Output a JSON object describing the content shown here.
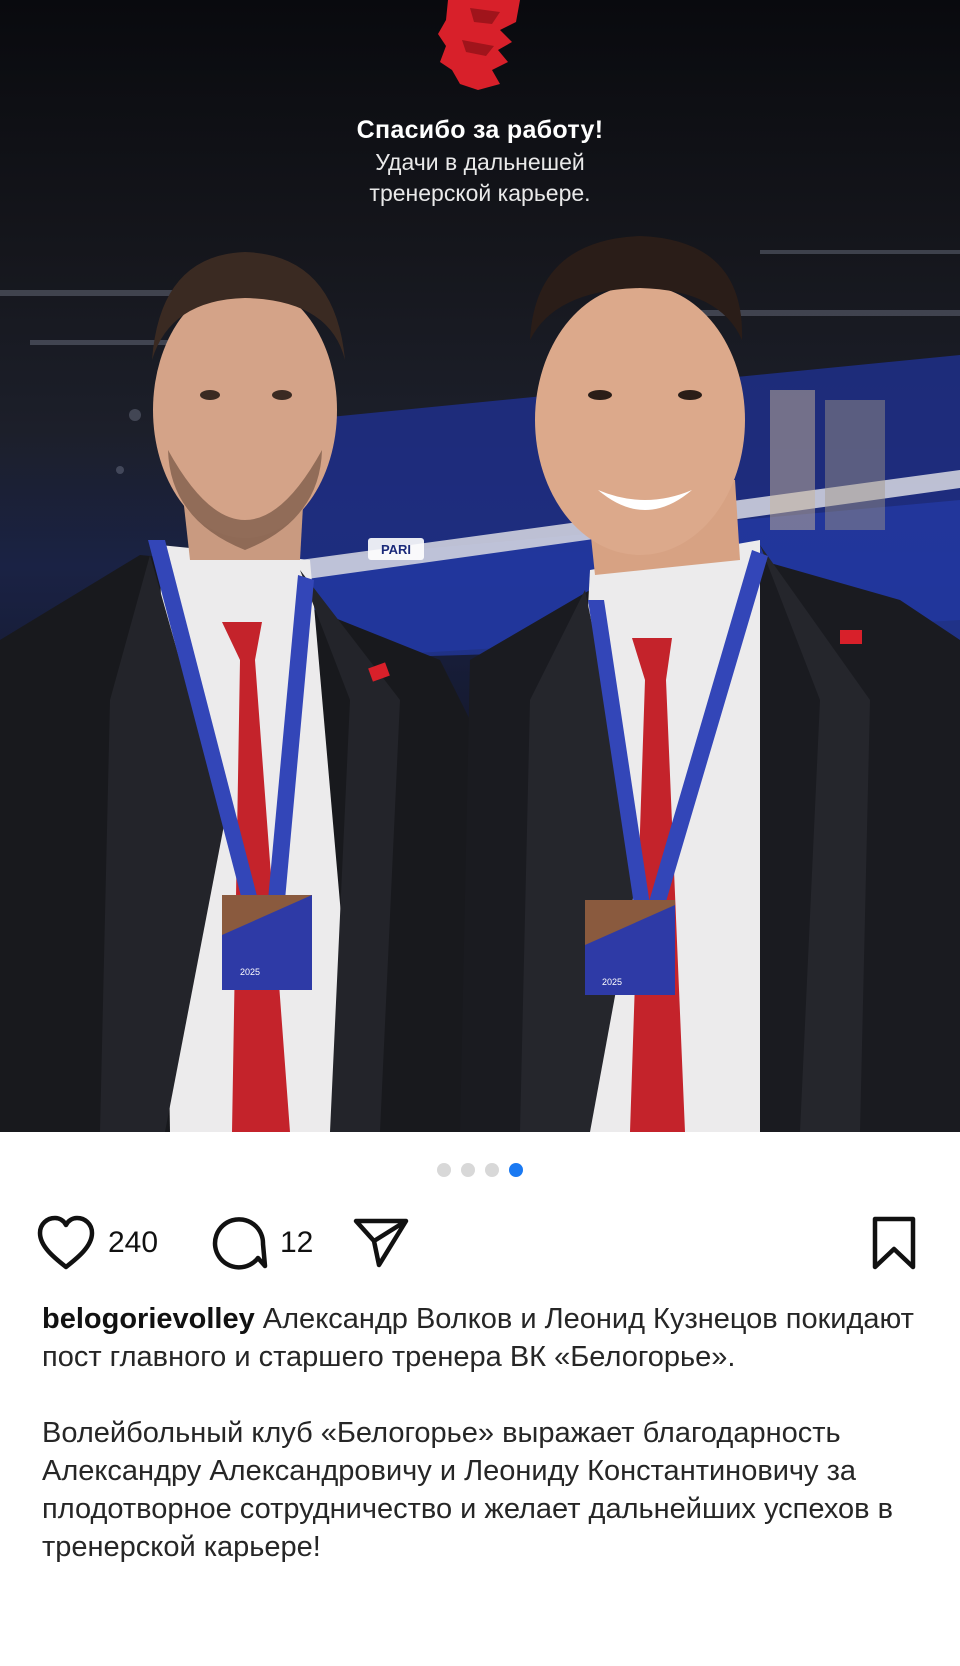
{
  "post": {
    "image": {
      "logo_icon": "lion-head-logo-icon",
      "thanks_title": "Спасибо за работу!",
      "thanks_line1": "Удачи в дальнешей",
      "thanks_line2": "тренерской карьере.",
      "banner_text": "PARI",
      "medal_text": "2025",
      "colors": {
        "background": "#0d0e12",
        "accent_red": "#d8202a",
        "lanyard_blue": "#3346b8"
      }
    },
    "carousel": {
      "total": 4,
      "active": 4
    },
    "actions": {
      "like_icon": "heart-icon",
      "likes": "240",
      "comment_icon": "comment-icon",
      "comments": "12",
      "share_icon": "send-icon",
      "save_icon": "bookmark-icon"
    },
    "caption": {
      "username": "belogorievolley",
      "text1": "Александр Волков и Леонид Кузнецов покидают пост главного и старшего тренера ВК «Белогорье».",
      "text2": "Волейбольный клуб «Белогорье» выражает благодарность Александру Александровичу и Леониду Константиновичу за плодотворное сотрудничество и желает дальнейших успехов в тренерской карьере!"
    }
  }
}
